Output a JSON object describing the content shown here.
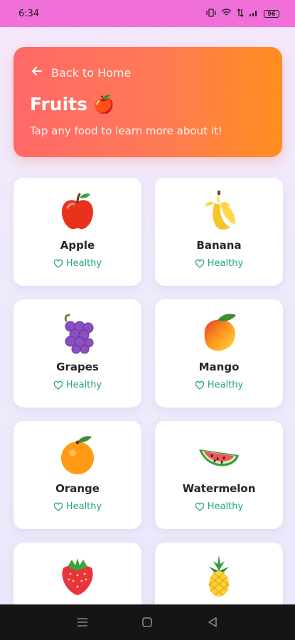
{
  "status_bar": {
    "time": "6:34",
    "battery": "96"
  },
  "header": {
    "back_label": "Back to Home",
    "title": "Fruits",
    "title_emoji": "🍎",
    "subtitle": "Tap any food to learn more about it!"
  },
  "foods": [
    {
      "name": "Apple",
      "tag": "Healthy",
      "icon": "apple-icon"
    },
    {
      "name": "Banana",
      "tag": "Healthy",
      "icon": "banana-icon"
    },
    {
      "name": "Grapes",
      "tag": "Healthy",
      "icon": "grapes-icon"
    },
    {
      "name": "Mango",
      "tag": "Healthy",
      "icon": "mango-icon"
    },
    {
      "name": "Orange",
      "tag": "Healthy",
      "icon": "orange-icon"
    },
    {
      "name": "Watermelon",
      "tag": "Healthy",
      "icon": "watermelon-icon"
    },
    {
      "name": "",
      "tag": "",
      "icon": "strawberry-icon"
    },
    {
      "name": "",
      "tag": "",
      "icon": "pineapple-icon"
    }
  ],
  "colors": {
    "status_bar": "#f06fd8",
    "header_start": "#ff6868",
    "header_end": "#ff8e1e",
    "healthy_tag": "#22a874",
    "nav_bar": "#151515"
  }
}
